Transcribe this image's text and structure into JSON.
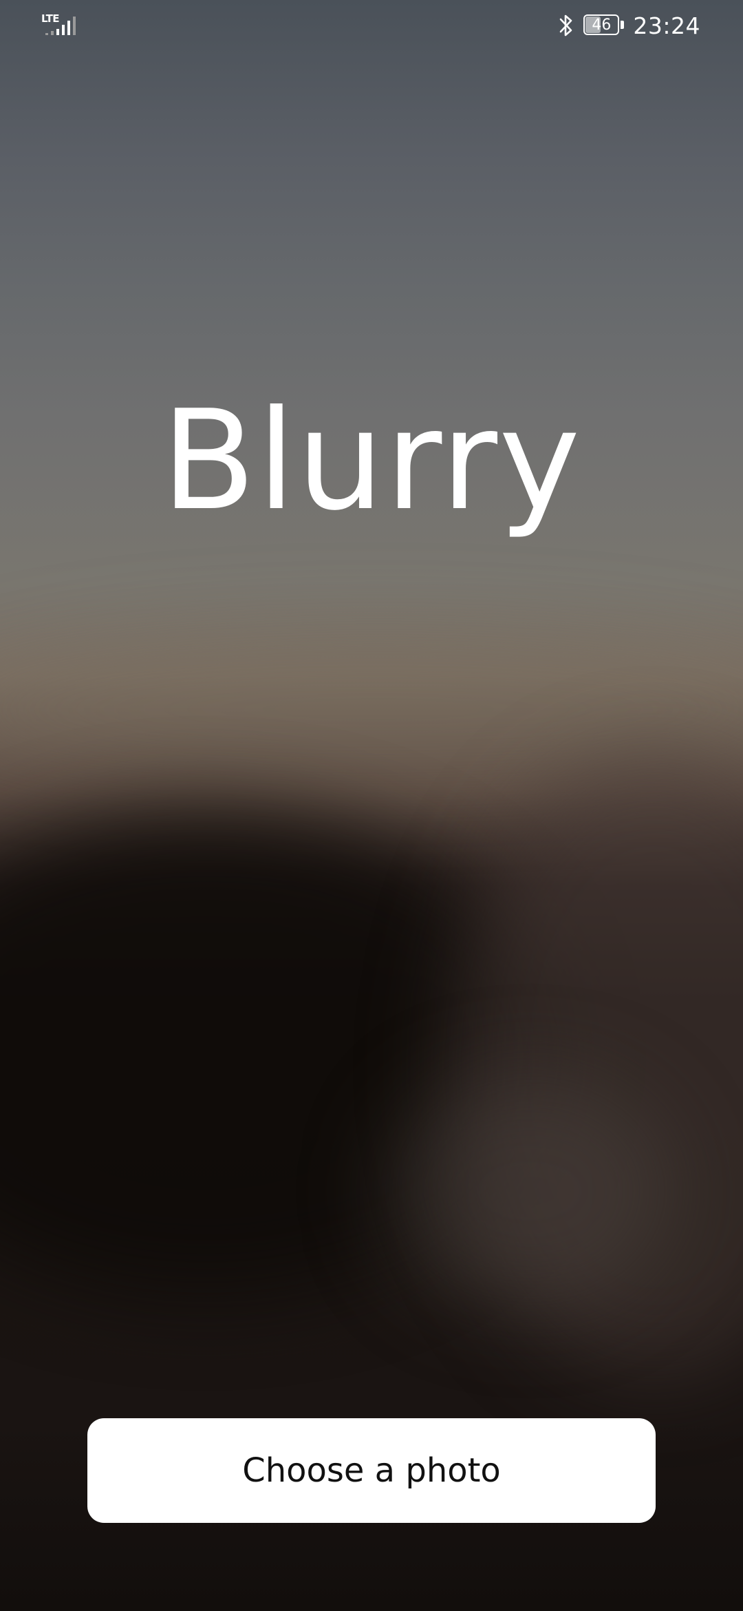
{
  "status_bar": {
    "network_label": "LTE",
    "icons": [
      "signal-icon",
      "bluetooth-icon",
      "battery-icon"
    ],
    "battery_level": "46",
    "time": "23:24"
  },
  "main": {
    "title": "Blurry",
    "choose_button_label": "Choose a photo"
  },
  "colors": {
    "button_background": "#ffffff",
    "button_text": "#111111",
    "title_text": "#ffffff"
  }
}
